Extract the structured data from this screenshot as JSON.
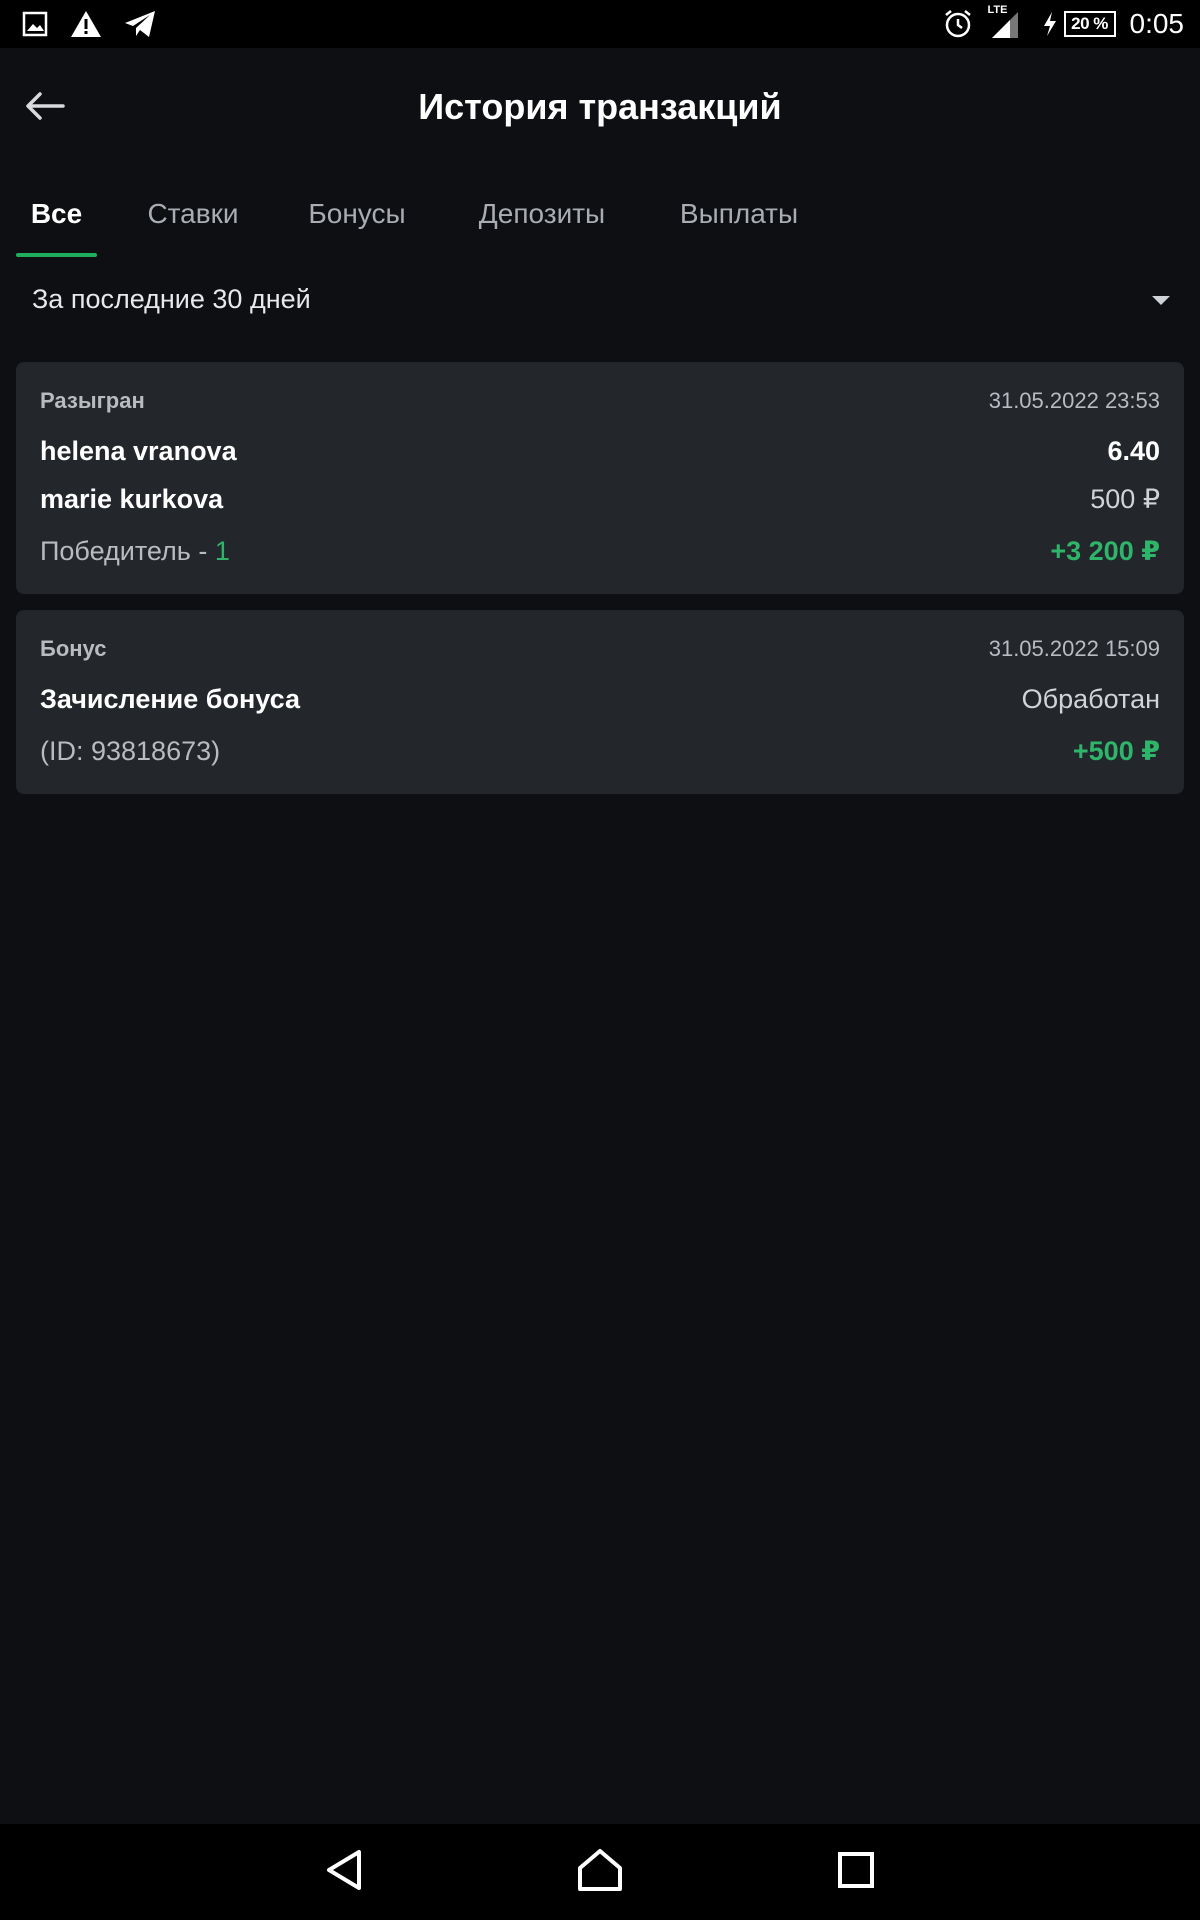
{
  "status_bar": {
    "time": "0:05",
    "battery": "20 %",
    "network": "LTE",
    "icons": [
      "image-icon",
      "warning-icon",
      "telegram-icon",
      "alarm-icon",
      "signal-icon",
      "charging-icon",
      "battery-icon"
    ]
  },
  "header": {
    "title": "История транзакций",
    "back_icon": "arrow-left-icon"
  },
  "tabs": [
    {
      "label": "Все",
      "active": true
    },
    {
      "label": "Ставки",
      "active": false
    },
    {
      "label": "Бонусы",
      "active": false
    },
    {
      "label": "Депозиты",
      "active": false
    },
    {
      "label": "Выплаты",
      "active": false
    }
  ],
  "filter": {
    "period": "За последние 30 дней",
    "icon": "chevron-down-icon"
  },
  "transactions": [
    {
      "type": "Разыгран",
      "date": "31.05.2022 23:53",
      "line1_left": "helena vranova",
      "line1_right": "6.40",
      "line2_left": "marie kurkova",
      "line2_right": "500 ₽",
      "line3_left": "Победитель - ",
      "line3_left_value": "1",
      "line3_right": "+3 200 ₽"
    },
    {
      "type": "Бонус",
      "date": "31.05.2022 15:09",
      "line1_left": "Зачисление бонуса",
      "line1_right": "Обработан",
      "line2_left": "(ID: 93818673)",
      "line2_right": "+500 ₽"
    }
  ],
  "nav_bar": {
    "icons": [
      "back-triangle-icon",
      "home-icon",
      "recents-icon"
    ]
  },
  "colors": {
    "background": "#0d0f12",
    "card": "#23262b",
    "accent_green": "#2fb56a",
    "muted_text": "#b8bbc0"
  }
}
